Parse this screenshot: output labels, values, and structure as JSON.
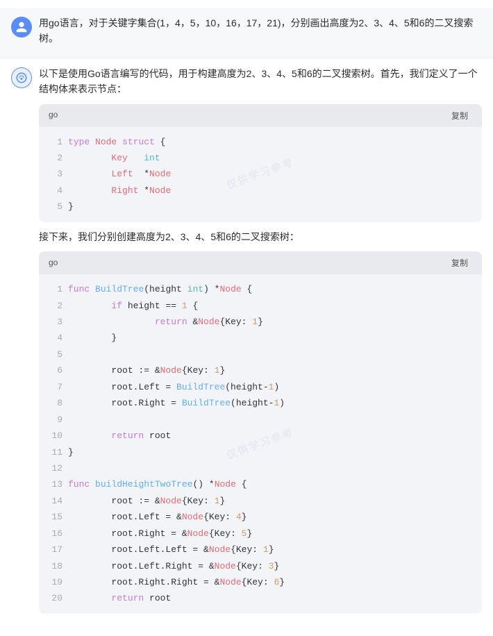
{
  "messages": [
    {
      "role": "user",
      "text": "用go语言，对于关键字集合(1，4，5，10，16，17，21)，分别画出高度为2、3、4、5和6的二叉搜索树。"
    },
    {
      "role": "assistant",
      "intro": "以下是使用Go语言编写的代码，用于构建高度为2、3、4、5和6的二叉搜索树。首先，我们定义了一个结构体来表示节点：",
      "code_block_1": {
        "lang": "go",
        "copy_label": "复制",
        "lines": [
          {
            "num": "1",
            "code": "type Node struct {"
          },
          {
            "num": "2",
            "code": "        Key   int"
          },
          {
            "num": "3",
            "code": "        Left  *Node"
          },
          {
            "num": "4",
            "code": "        Right *Node"
          },
          {
            "num": "5",
            "code": "}"
          }
        ]
      },
      "middle_text": "接下来，我们分别创建高度为2、3、4、5和6的二叉搜索树：",
      "code_block_2": {
        "lang": "go",
        "copy_label": "复制",
        "lines": [
          {
            "num": "1",
            "code": "func BuildTree(height int) *Node {"
          },
          {
            "num": "2",
            "code": "        if height == 1 {"
          },
          {
            "num": "3",
            "code": "                return &Node{Key: 1}"
          },
          {
            "num": "4",
            "code": "        }"
          },
          {
            "num": "5",
            "code": ""
          },
          {
            "num": "6",
            "code": "        root := &Node{Key: 1}"
          },
          {
            "num": "7",
            "code": "        root.Left = BuildTree(height-1)"
          },
          {
            "num": "8",
            "code": "        root.Right = BuildTree(height-1)"
          },
          {
            "num": "9",
            "code": ""
          },
          {
            "num": "10",
            "code": "        return root"
          },
          {
            "num": "11",
            "code": "}"
          },
          {
            "num": "12",
            "code": ""
          },
          {
            "num": "13",
            "code": "func buildHeightTwoTree() *Node {"
          },
          {
            "num": "14",
            "code": "        root := &Node{Key: 1}"
          },
          {
            "num": "15",
            "code": "        root.Left = &Node{Key: 4}"
          },
          {
            "num": "16",
            "code": "        root.Right = &Node{Key: 5}"
          },
          {
            "num": "17",
            "code": "        root.Left.Left = &Node{Key: 1}"
          },
          {
            "num": "18",
            "code": "        root.Left.Right = &Node{Key: 3}"
          },
          {
            "num": "19",
            "code": "        root.Right.Right = &Node{Key: 6}"
          },
          {
            "num": "20",
            "code": "        return root"
          }
        ]
      }
    }
  ],
  "icons": {
    "user": "person",
    "assistant": "sparkle"
  },
  "colors": {
    "user_bg": "#5b8ef5",
    "assistant_accent": "#5b8ef5",
    "code_bg": "#f3f4f7",
    "code_header_bg": "#e8eaee"
  }
}
